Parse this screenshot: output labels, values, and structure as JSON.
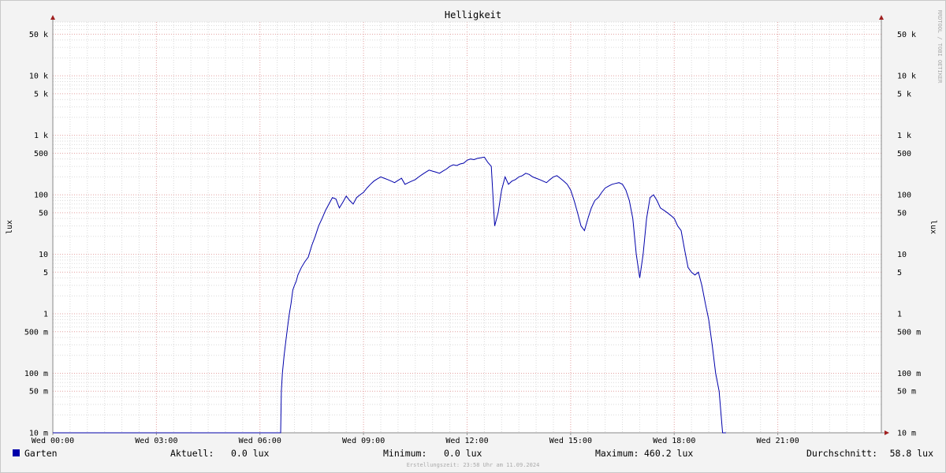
{
  "chart_data": {
    "type": "line",
    "title": "Helligkeit",
    "ylabel": "lux",
    "scale_y": "log",
    "ylim": [
      0.01,
      80000
    ],
    "xlim_hours": [
      0,
      24
    ],
    "x_ticks": [
      {
        "h": 0,
        "label": "Wed 00:00"
      },
      {
        "h": 3,
        "label": "Wed 03:00"
      },
      {
        "h": 6,
        "label": "Wed 06:00"
      },
      {
        "h": 9,
        "label": "Wed 09:00"
      },
      {
        "h": 12,
        "label": "Wed 12:00"
      },
      {
        "h": 15,
        "label": "Wed 15:00"
      },
      {
        "h": 18,
        "label": "Wed 18:00"
      },
      {
        "h": 21,
        "label": "Wed 21:00"
      }
    ],
    "y_ticks": [
      {
        "v": 0.01,
        "label": "10 m"
      },
      {
        "v": 0.05,
        "label": "50 m"
      },
      {
        "v": 0.1,
        "label": "100 m"
      },
      {
        "v": 0.5,
        "label": "500 m"
      },
      {
        "v": 1,
        "label": "1"
      },
      {
        "v": 5,
        "label": "5"
      },
      {
        "v": 10,
        "label": "10"
      },
      {
        "v": 50,
        "label": "50"
      },
      {
        "v": 100,
        "label": "100"
      },
      {
        "v": 500,
        "label": "500"
      },
      {
        "v": 1000,
        "label": "1 k"
      },
      {
        "v": 5000,
        "label": "5 k"
      },
      {
        "v": 10000,
        "label": "10 k"
      },
      {
        "v": 50000,
        "label": "50 k"
      }
    ],
    "grid": true,
    "series": [
      {
        "name": "Garten",
        "color": "#0000aa",
        "x_hours": [
          0,
          6.6,
          6.62,
          6.65,
          6.7,
          6.75,
          6.8,
          6.85,
          6.9,
          6.95,
          7.0,
          7.05,
          7.1,
          7.2,
          7.3,
          7.4,
          7.5,
          7.6,
          7.7,
          7.8,
          7.9,
          8.0,
          8.1,
          8.2,
          8.3,
          8.4,
          8.5,
          8.6,
          8.7,
          8.8,
          8.9,
          9.0,
          9.1,
          9.2,
          9.3,
          9.4,
          9.5,
          9.6,
          9.7,
          9.8,
          9.9,
          10.0,
          10.1,
          10.2,
          10.3,
          10.4,
          10.5,
          10.6,
          10.7,
          10.8,
          10.9,
          11.0,
          11.1,
          11.2,
          11.3,
          11.4,
          11.5,
          11.6,
          11.7,
          11.8,
          11.9,
          12.0,
          12.1,
          12.2,
          12.3,
          12.4,
          12.5,
          12.6,
          12.7,
          12.8,
          12.9,
          13.0,
          13.1,
          13.2,
          13.3,
          13.4,
          13.5,
          13.6,
          13.7,
          13.8,
          13.9,
          14.0,
          14.1,
          14.2,
          14.3,
          14.4,
          14.5,
          14.6,
          14.7,
          14.8,
          14.9,
          15.0,
          15.1,
          15.2,
          15.3,
          15.4,
          15.5,
          15.6,
          15.7,
          15.8,
          15.9,
          16.0,
          16.1,
          16.2,
          16.3,
          16.4,
          16.5,
          16.6,
          16.7,
          16.8,
          16.9,
          17.0,
          17.1,
          17.2,
          17.3,
          17.4,
          17.5,
          17.6,
          17.7,
          17.8,
          17.9,
          18.0,
          18.1,
          18.2,
          18.3,
          18.4,
          18.5,
          18.6,
          18.7,
          18.8,
          18.9,
          19.0,
          19.1,
          19.2,
          19.3,
          19.4,
          19.5,
          19.6,
          19.7,
          19.8,
          19.9,
          20.0,
          20.1,
          20.2,
          20.3,
          20.4,
          20.5,
          20.6,
          20.62,
          20.65,
          24
        ],
        "values": [
          0.01,
          0.01,
          0.05,
          0.1,
          0.2,
          0.35,
          0.6,
          1.0,
          1.5,
          2.5,
          3.0,
          3.5,
          4.5,
          6.0,
          7.5,
          9.0,
          14,
          20,
          30,
          40,
          55,
          70,
          90,
          85,
          60,
          75,
          95,
          80,
          70,
          90,
          100,
          110,
          130,
          150,
          170,
          185,
          200,
          190,
          180,
          170,
          160,
          175,
          190,
          150,
          160,
          170,
          180,
          200,
          220,
          240,
          260,
          250,
          240,
          230,
          250,
          270,
          300,
          320,
          310,
          330,
          340,
          380,
          400,
          390,
          410,
          420,
          430,
          350,
          300,
          30,
          50,
          120,
          200,
          150,
          170,
          180,
          200,
          210,
          230,
          220,
          200,
          190,
          180,
          170,
          160,
          180,
          200,
          210,
          190,
          170,
          150,
          120,
          80,
          50,
          30,
          25,
          40,
          60,
          80,
          90,
          110,
          130,
          140,
          150,
          155,
          160,
          150,
          120,
          80,
          40,
          10,
          4,
          10,
          40,
          90,
          100,
          80,
          60,
          55,
          50,
          45,
          40,
          30,
          25,
          12,
          6,
          5,
          4.5,
          5,
          3,
          1.5,
          0.8,
          0.3,
          0.1,
          0.05,
          0.01,
          0.01
        ]
      }
    ]
  },
  "watermark": "RRDTOOL / TOBI OETIKER",
  "legend": {
    "series_name": "Garten",
    "series_color": "#0000aa",
    "current_label": "Aktuell:",
    "current_value": "0.0 lux",
    "min_label": "Minimum:",
    "min_value": "0.0 lux",
    "max_label": "Maximum:",
    "max_value": "460.2 lux",
    "avg_label": "Durchschnitt:",
    "avg_value": "58.8 lux"
  },
  "footer": "Erstellungszeit: 23:58 Uhr am 11.09.2024"
}
